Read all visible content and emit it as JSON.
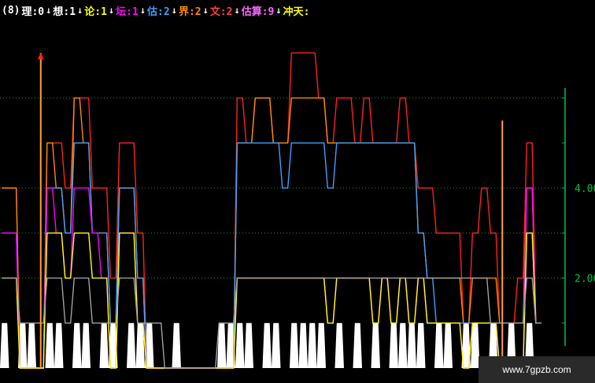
{
  "legend": {
    "period_label": "(8)",
    "items": [
      {
        "name": "理",
        "value": "0",
        "color": "#ffffff",
        "arrow": "down",
        "arrow_color": "#ffffff"
      },
      {
        "name": "想",
        "value": "1",
        "color": "#ffffff",
        "arrow": "down",
        "arrow_color": "#ffffff"
      },
      {
        "name": "论",
        "value": "1",
        "color": "#ffff00",
        "arrow": "down",
        "arrow_color": "#ffffff"
      },
      {
        "name": "坛",
        "value": "1",
        "color": "#ff00ff",
        "arrow": "down",
        "arrow_color": "#ffffff"
      },
      {
        "name": "估",
        "value": "2",
        "color": "#3ca0ff",
        "arrow": "down",
        "arrow_color": "#ffffff"
      },
      {
        "name": "界",
        "value": "2",
        "color": "#ff8800",
        "arrow": "down",
        "arrow_color": "#ffffff"
      },
      {
        "name": "文",
        "value": "2",
        "color": "#ff4040",
        "arrow": "down",
        "arrow_color": "#ffffff"
      },
      {
        "name": "估算",
        "value": "9",
        "color": "#ff66ff",
        "arrow": "down",
        "arrow_color": "#ffffff"
      },
      {
        "name": "冲天",
        "value": "",
        "color": "#ffff00",
        "arrow": "",
        "arrow_color": "#ffffff"
      }
    ]
  },
  "chart_data": {
    "type": "line",
    "title": "",
    "ylim": [
      0,
      7.6
    ],
    "y_ticks": [
      "4.00",
      "2.00"
    ],
    "y_tick_values": [
      4,
      2
    ],
    "grid_levels": [
      6,
      4,
      3,
      2
    ],
    "grid": "dotted-green",
    "axis_color": "#00c040",
    "series": [
      {
        "color": "#ff2020",
        "values": [
          4,
          4,
          0,
          0,
          0,
          5,
          5,
          4,
          6,
          6,
          4,
          4,
          2,
          5,
          5,
          3,
          0,
          0,
          0,
          0,
          0,
          0,
          0,
          0,
          0,
          0,
          6,
          5,
          6,
          6,
          5,
          5,
          7,
          7,
          7,
          6,
          5,
          6,
          6,
          5,
          6,
          5,
          5,
          5,
          6,
          5,
          4,
          4,
          3,
          3,
          3,
          1,
          3,
          4,
          3,
          1,
          1,
          2,
          5,
          1
        ]
      },
      {
        "color": "#ff8800",
        "values": [
          4,
          4,
          0,
          0,
          0,
          5,
          4,
          3,
          6,
          5,
          3,
          3,
          1,
          4,
          4,
          2,
          0,
          0,
          0,
          0,
          0,
          0,
          0,
          0,
          0,
          0,
          5,
          5,
          6,
          6,
          5,
          5,
          6,
          6,
          6,
          6,
          5,
          5,
          5,
          5,
          5,
          5,
          5,
          5,
          5,
          5,
          3,
          2,
          2,
          2,
          2,
          1,
          2,
          2,
          2,
          1,
          1,
          1,
          4,
          1
        ]
      },
      {
        "color": "#3ca0ff",
        "values": [
          3,
          3,
          0,
          0,
          0,
          4,
          4,
          3,
          5,
          5,
          3,
          3,
          1,
          4,
          4,
          2,
          0,
          0,
          0,
          0,
          0,
          0,
          0,
          0,
          0,
          0,
          5,
          5,
          5,
          5,
          5,
          4,
          5,
          5,
          5,
          5,
          4,
          5,
          5,
          5,
          5,
          5,
          5,
          5,
          5,
          5,
          3,
          2,
          1,
          1,
          1,
          1,
          1,
          1,
          1,
          1,
          1,
          1,
          3,
          1
        ]
      },
      {
        "color": "#ff00ff",
        "values": [
          3,
          3,
          0,
          0,
          0,
          4,
          3,
          2,
          4,
          4,
          3,
          2,
          0,
          3,
          3,
          1,
          0,
          0,
          0,
          0,
          0,
          0,
          0,
          0,
          0,
          0,
          2,
          2,
          2,
          2,
          2,
          2,
          2,
          2,
          2,
          2,
          1,
          2,
          2,
          2,
          2,
          1,
          2,
          1,
          2,
          1,
          2,
          1,
          1,
          1,
          1,
          0,
          1,
          1,
          1,
          0,
          0,
          0,
          4,
          1
        ]
      },
      {
        "color": "#ffff00",
        "values": [
          2,
          2,
          0,
          0,
          0,
          3,
          3,
          2,
          3,
          3,
          2,
          2,
          0,
          3,
          3,
          1,
          0,
          0,
          0,
          0,
          0,
          0,
          0,
          0,
          0,
          0,
          2,
          2,
          2,
          2,
          2,
          2,
          2,
          2,
          2,
          2,
          1,
          2,
          2,
          2,
          2,
          1,
          2,
          1,
          2,
          1,
          2,
          1,
          1,
          1,
          1,
          0,
          1,
          1,
          1,
          0,
          0,
          0,
          3,
          1
        ]
      },
      {
        "color": "#a0a0a0",
        "values": [
          2,
          2,
          1,
          1,
          1,
          2,
          2,
          1,
          2,
          2,
          1,
          1,
          1,
          2,
          2,
          1,
          1,
          1,
          0,
          0,
          0,
          0,
          0,
          0,
          1,
          1,
          2,
          2,
          2,
          2,
          2,
          2,
          2,
          2,
          2,
          2,
          2,
          2,
          2,
          2,
          2,
          2,
          2,
          2,
          2,
          2,
          2,
          2,
          2,
          2,
          2,
          2,
          2,
          2,
          1,
          1,
          1,
          1,
          2,
          1
        ]
      }
    ],
    "area": {
      "color": "#ffffff",
      "values": [
        1,
        0,
        1,
        1,
        0,
        1,
        1,
        0,
        1,
        1,
        0,
        1,
        1,
        0,
        1,
        1,
        1,
        0,
        0,
        1,
        0,
        0,
        0,
        0,
        1,
        1,
        1,
        1,
        0,
        1,
        1,
        0,
        1,
        1,
        1,
        1,
        0,
        1,
        0,
        1,
        0,
        1,
        0,
        1,
        1,
        1,
        1,
        0,
        1,
        1,
        0,
        1,
        1,
        0,
        1,
        0,
        1,
        0,
        1,
        0
      ]
    },
    "signals": [
      {
        "index": 4,
        "height": 7,
        "color": "#ffa040",
        "arrow": true
      },
      {
        "index": 55,
        "height": 5.5,
        "color": "#ffa040",
        "arrow": false
      }
    ]
  },
  "watermark": "www.7gpzb.com"
}
